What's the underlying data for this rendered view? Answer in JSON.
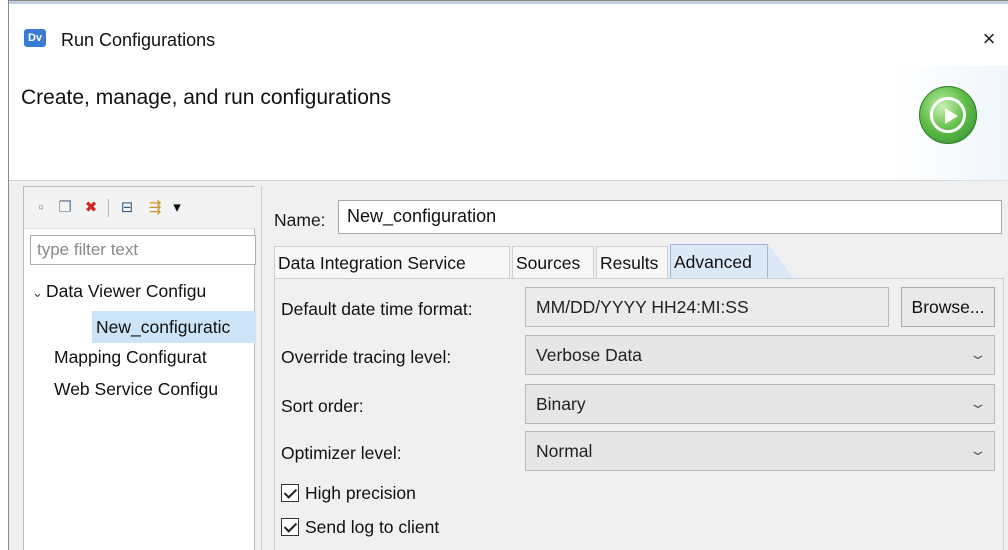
{
  "window": {
    "app_icon_text": "Dv",
    "title": "Run Configurations",
    "close_glyph": "×"
  },
  "header": {
    "title": "Create, manage, and run configurations",
    "icon": "run-play-icon",
    "icon_color": "#4caf3a"
  },
  "left_panel": {
    "toolbar": [
      {
        "name": "new-configuration-icon",
        "glyph": "▫"
      },
      {
        "name": "duplicate-icon",
        "glyph": "❐"
      },
      {
        "name": "delete-icon",
        "glyph": "✖"
      },
      {
        "name": "collapse-all-icon",
        "glyph": "⊟"
      },
      {
        "name": "filter-icon",
        "glyph": "⇶"
      },
      {
        "name": "dropdown-arrow-icon",
        "glyph": "▾"
      }
    ],
    "filter_placeholder": "type filter text",
    "tree": [
      {
        "label": "Data Viewer Configu",
        "expanded": true,
        "level": 0
      },
      {
        "label": "New_configuratic",
        "selected": true,
        "level": 1
      },
      {
        "label": "Mapping Configurat",
        "level": 0
      },
      {
        "label": "Web Service Configu",
        "level": 0
      }
    ]
  },
  "right_panel": {
    "name_label": "Name:",
    "name_value": "New_configuration",
    "tabs": [
      {
        "label": "Data Integration Service"
      },
      {
        "label": "Sources"
      },
      {
        "label": "Results"
      },
      {
        "label": "Advanced",
        "active": true
      }
    ],
    "fields": {
      "date_format_label": "Default date time format:",
      "date_format_value": "MM/DD/YYYY HH24:MI:SS",
      "browse_label": "Browse...",
      "tracing_label": "Override tracing level:",
      "tracing_value": "Verbose Data",
      "sort_label": "Sort order:",
      "sort_value": "Binary",
      "optimizer_label": "Optimizer level:",
      "optimizer_value": "Normal"
    },
    "checkboxes": [
      {
        "label": "High precision",
        "checked": true
      },
      {
        "label": "Send log to client",
        "checked": true
      }
    ],
    "chevron_glyph": "⌄"
  },
  "colors": {
    "selection": "#cce4f7",
    "active_tab": "#dbe8f6",
    "delete_red": "#d0281e"
  }
}
